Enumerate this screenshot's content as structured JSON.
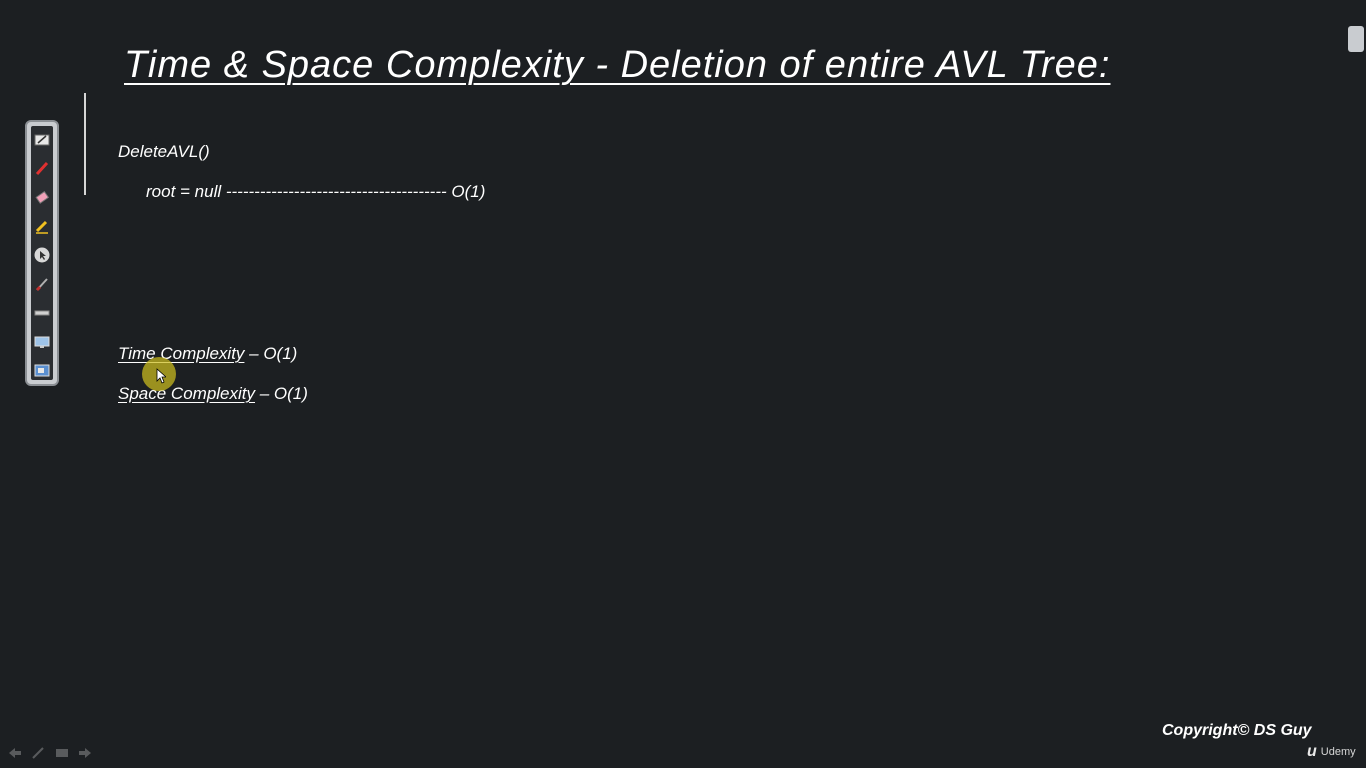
{
  "slide": {
    "title": "Time & Space Complexity - Deletion of entire AVL Tree:",
    "code": {
      "function": "DeleteAVL()",
      "statement": "root = null --------------------------------------- O(1)"
    },
    "complexity": {
      "time_label": "Time Complexity",
      "time_value": " – O(1)",
      "space_label": "Space Complexity",
      "space_value": " – O(1)"
    }
  },
  "footer": {
    "copyright": "Copyright© DS Guy",
    "brand": "Udemy"
  },
  "toolbar": {
    "tools": [
      "pen-and-paper-icon",
      "red-pen-icon",
      "eraser-icon",
      "highlighter-icon",
      "pointer-icon",
      "brush-icon",
      "ruler-icon",
      "screen-icon",
      "screen-capture-icon"
    ]
  },
  "colors": {
    "background": "#1c1f22",
    "text": "#ffffff",
    "cursor_highlight": "#cdbe1e"
  }
}
